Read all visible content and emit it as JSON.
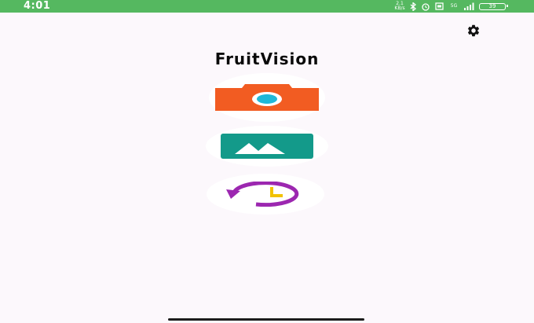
{
  "status_bar": {
    "time": "4:01",
    "network_speed": "2.1 KB/s",
    "signal": "5G",
    "battery": "39"
  },
  "app": {
    "title": "FruitVision"
  },
  "icons": {
    "settings": "gear-icon",
    "camera": "camera-icon",
    "gallery": "gallery-icon",
    "history": "history-icon"
  },
  "colors": {
    "status_bar": "#55b860",
    "camera": "#f25c22",
    "camera_lens": "#1fb8d8",
    "gallery": "#139a8a",
    "history": "#9c27b0",
    "history_clock": "#f2c200"
  }
}
